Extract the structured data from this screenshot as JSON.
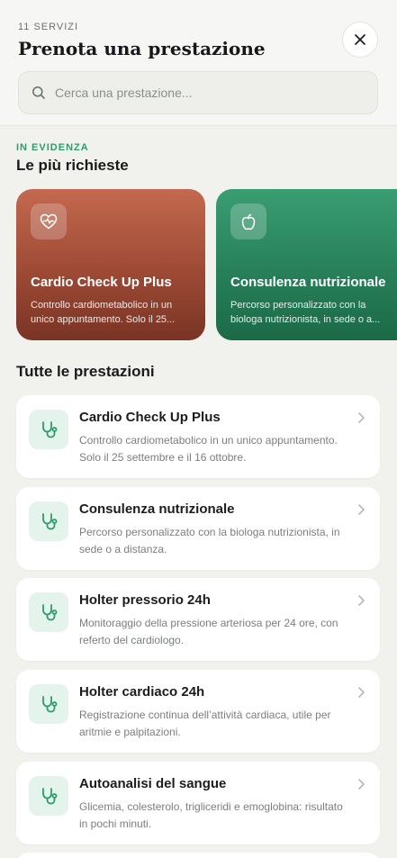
{
  "header": {
    "count": "11 SERVIZI",
    "title": "Prenota una prestazione",
    "close_icon": "close-icon"
  },
  "search": {
    "placeholder": "Cerca una prestazione...",
    "value": "",
    "icon": "search-icon"
  },
  "featured": {
    "eyebrow": "IN EVIDENZA",
    "title": "Le più richieste",
    "items": [
      {
        "title": "Cardio Check Up Plus",
        "desc_line1": "Controllo cardiometabolico in un",
        "desc_line2": "unico appuntamento. Solo il 25...",
        "icon": "heart-pulse-icon",
        "color": "#9d4a35"
      },
      {
        "title": "Consulenza nutrizionale",
        "desc_line1": "Percorso personalizzato con la",
        "desc_line2": "biologa nutrizionista, in sede o a...",
        "icon": "apple-icon",
        "color": "#27805a"
      }
    ]
  },
  "all": {
    "title": "Tutte le prestazioni",
    "items": [
      {
        "title": "Cardio Check Up Plus",
        "desc": "Controllo cardiometabolico in un unico appuntamento. Solo il 25 settembre e il 16 ottobre."
      },
      {
        "title": "Consulenza nutrizionale",
        "desc": "Percorso personalizzato con la biologa nutrizionista, in sede o a distanza."
      },
      {
        "title": "Holter pressorio 24h",
        "desc": "Monitoraggio della pressione arteriosa per 24 ore, con referto del cardiologo."
      },
      {
        "title": "Holter cardiaco 24h",
        "desc": "Registrazione continua dell’attività cardiaca, utile per aritmie e palpitazioni."
      },
      {
        "title": "Autoanalisi del sangue",
        "desc": "Glicemia, colesterolo, trigliceridi e emoglobina: risultato in pochi minuti."
      }
    ],
    "item_icon": "stethoscope-icon",
    "chevron_icon": "chevron-right-icon"
  },
  "colors": {
    "accent": "#2e9b6a",
    "background": "#f1f2ee"
  }
}
